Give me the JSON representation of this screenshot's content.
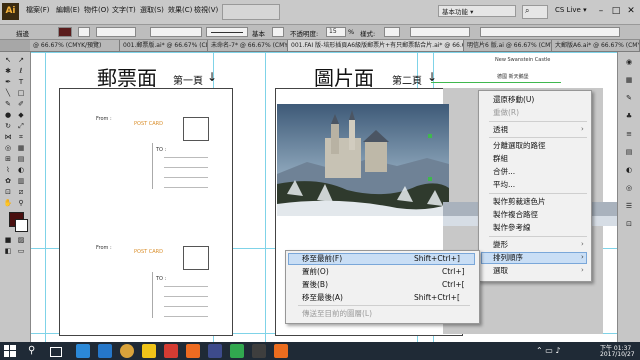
{
  "app": {
    "logo": "Ai"
  },
  "menubar": {
    "items": [
      "檔案(F)",
      "編輯(E)",
      "物件(O)",
      "文字(T)",
      "選取(S)",
      "效果(C)",
      "檢視(V)"
    ],
    "workspace": "基本功能 ▾",
    "cslive": "CS Live ▾",
    "window_controls": [
      "–",
      "□",
      "✕"
    ]
  },
  "controlbar": {
    "label_select": "描邊",
    "stroke_label": "基本",
    "opacity_label": "不透明度:",
    "opacity_value": "15",
    "opacity_unit": "%",
    "style_label": "樣式:"
  },
  "tabs": [
    "@ 66.67% (CMYK/預覽)",
    "001.郵票版.ai* @ 66.67% (CMYK/預覽)",
    "未命名-7* @ 66.67% (CMYK/預覽)",
    "001.FAI 版-培形插頁A6級版郵票片+有只郵票黏合片.ai* @ 66.67% (CMYK/預覽)",
    "明信片6 版.ai @ 66.67% (CMYK/預覽)",
    "大郵版A6.ai* @ 66.67% (CMYK/預覽)"
  ],
  "canvas": {
    "title_stamp": "郵票面",
    "title_stamp_sub": "第一頁",
    "title_photo": "圖片面",
    "title_photo_sub": "第二頁",
    "arrow": "↓",
    "postcard_label": "POST CARD",
    "from_label": "From :",
    "to_label": "TO :",
    "header_small": "New Swanstein Castle",
    "header_small2": "德國  新天鵝堡"
  },
  "context_menu": {
    "items": [
      {
        "label": "還原移動(U)",
        "disabled": false
      },
      {
        "label": "重做(R)",
        "disabled": true
      },
      {
        "label": "透視",
        "disabled": false,
        "submenu": true
      },
      {
        "label": "分離選取的路徑",
        "disabled": false
      },
      {
        "label": "群組",
        "disabled": false
      },
      {
        "label": "合併...",
        "disabled": false
      },
      {
        "label": "平均...",
        "disabled": false
      },
      {
        "label": "製作剪裁遮色片",
        "disabled": false
      },
      {
        "label": "製作複合路徑",
        "disabled": false
      },
      {
        "label": "製作參考線",
        "disabled": false
      },
      {
        "label": "變形",
        "disabled": false,
        "submenu": true
      },
      {
        "label": "排列順序",
        "disabled": false,
        "submenu": true,
        "highlight": true
      },
      {
        "label": "選取",
        "disabled": false,
        "submenu": true
      }
    ]
  },
  "arrange_menu": {
    "items": [
      {
        "label": "移至最前(F)",
        "shortcut": "Shift+Ctrl+]",
        "highlight": true
      },
      {
        "label": "置前(O)",
        "shortcut": "Ctrl+]"
      },
      {
        "label": "置後(B)",
        "shortcut": "Ctrl+["
      },
      {
        "label": "移至最後(A)",
        "shortcut": "Shift+Ctrl+["
      },
      {
        "label": "傳送至目前的圖層(L)",
        "shortcut": "",
        "disabled": true
      }
    ]
  },
  "taskbar": {
    "time": "下午 01:37",
    "date": "2017/10/27",
    "colors": [
      "#2b89d8",
      "#2577c9",
      "#d9a33b",
      "#f0c419",
      "#d43c33",
      "#2f6fd0",
      "#ed6b21",
      "#3d4b8c",
      "#31a84f",
      "#3e3e3e",
      "#ec6d1f"
    ]
  },
  "colors": {
    "highlight": "#c9def5",
    "highlight_border": "#7aa7d9",
    "guide": "#7fd3e8",
    "selection": "#3fb84e"
  }
}
